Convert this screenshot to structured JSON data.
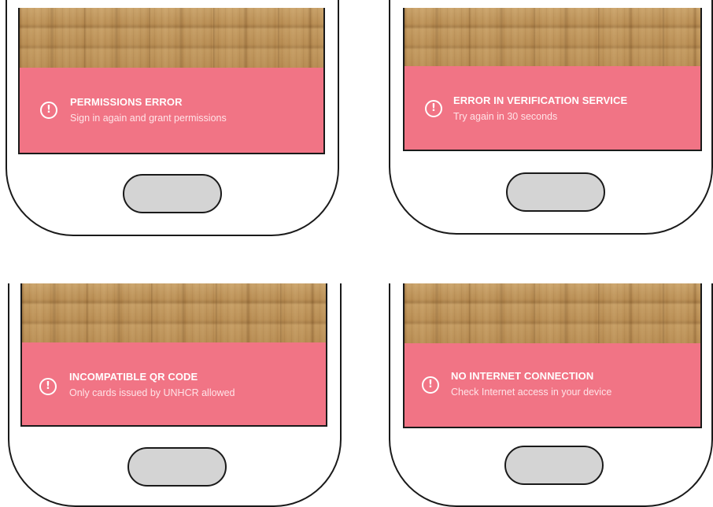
{
  "screens": [
    {
      "id": "permissions",
      "title": "PERMISSIONS ERROR",
      "message": "Sign in again and grant permissions",
      "icon": "alert-circle-icon"
    },
    {
      "id": "verification",
      "title": "ERROR IN VERIFICATION SERVICE",
      "message": "Try again in 30 seconds",
      "icon": "alert-circle-icon"
    },
    {
      "id": "qr",
      "title": "INCOMPATIBLE QR CODE",
      "message": "Only cards issued by UNHCR allowed",
      "icon": "alert-circle-icon"
    },
    {
      "id": "internet",
      "title": "NO INTERNET CONNECTION",
      "message": "Check Internet access in your device",
      "icon": "alert-circle-icon"
    }
  ],
  "colors": {
    "banner": "#f17485",
    "text": "#ffffff",
    "home_button": "#d4d4d4",
    "outline": "#1a1a1a",
    "wood": "#b98d52"
  }
}
